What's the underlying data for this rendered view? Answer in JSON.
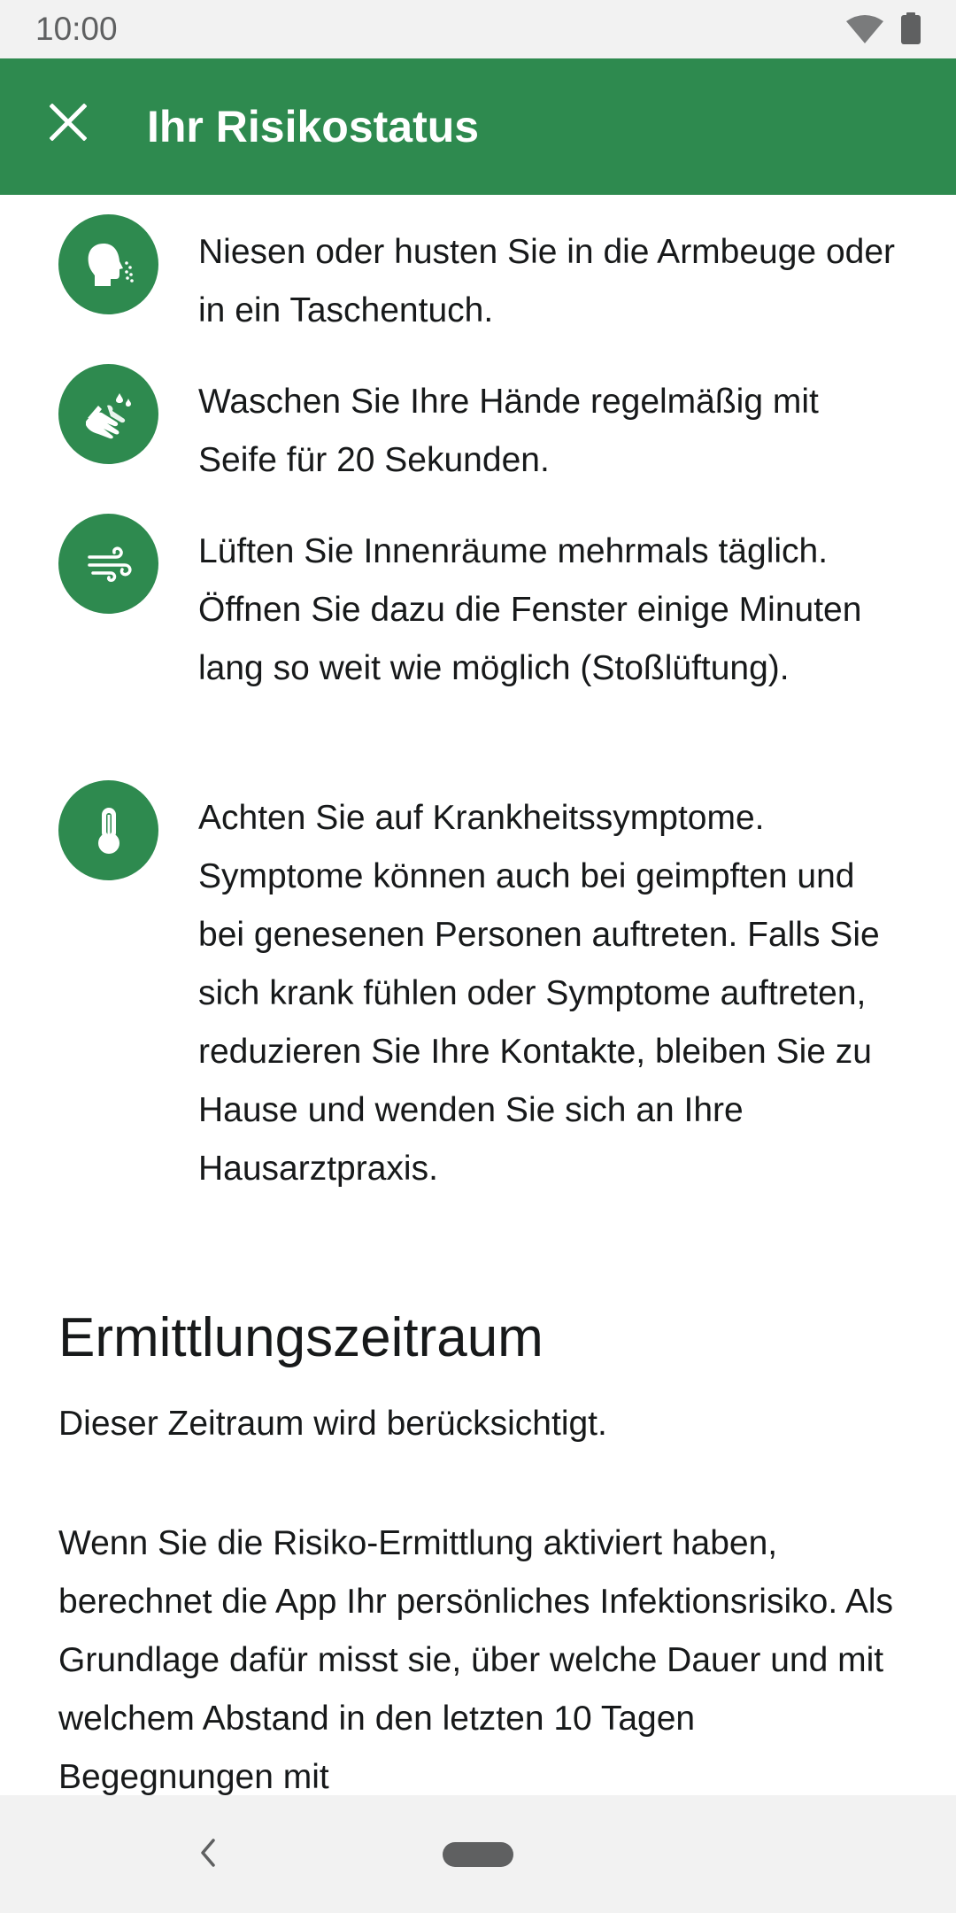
{
  "status_bar": {
    "time": "10:00",
    "wifi_icon": "wifi-icon",
    "battery_icon": "battery-icon"
  },
  "app_bar": {
    "title": "Ihr Risikostatus",
    "close_icon": "close-icon",
    "background_color": "#2e8a4f"
  },
  "tips": [
    {
      "icon": "sneeze-icon",
      "text": "Niesen oder husten Sie in die Armbeuge oder in ein Taschentuch."
    },
    {
      "icon": "hand-wash-icon",
      "text": "Waschen Sie Ihre Hände regelmäßig mit Seife für 20 Sekunden."
    },
    {
      "icon": "ventilation-icon",
      "text": "Lüften Sie Innenräume mehrmals täglich. Öffnen Sie dazu die Fenster einige Minuten lang so weit wie möglich (Stoßlüftung)."
    },
    {
      "icon": "thermometer-icon",
      "text": "Achten Sie auf Krankheitssymptome. Symptome können auch bei geimpften und bei genesenen Personen auftreten. Falls Sie sich krank fühlen oder Symptome auftreten, reduzieren Sie Ihre Kontakte, bleiben Sie zu Hause und wenden Sie sich an Ihre Hausarztpraxis."
    }
  ],
  "section": {
    "title": "Ermittlungszeitraum",
    "subtitle": "Dieser Zeitraum wird berücksichtigt.",
    "body": "Wenn Sie die Risiko-Ermittlung aktiviert haben, berechnet die App Ihr persönliches Infektionsrisiko. Als Grundlage dafür misst sie, über welche Dauer und mit welchem Abstand in den letzten 10 Tagen Begegnungen mit"
  },
  "nav_bar": {
    "back_icon": "back-chevron-icon",
    "home_icon": "home-pill-icon"
  }
}
